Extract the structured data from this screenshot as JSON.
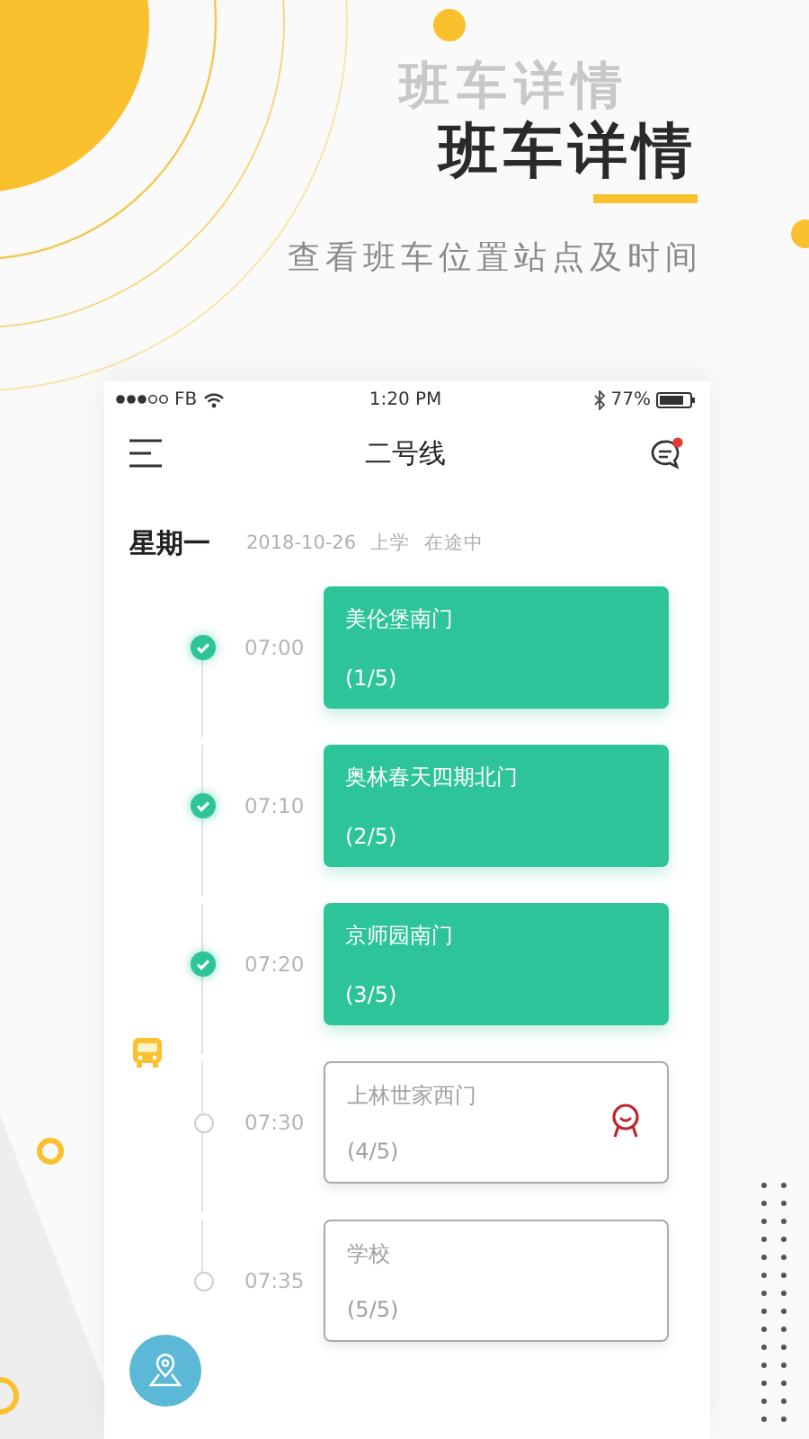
{
  "promo": {
    "title_echo": "班车详情",
    "title": "班车详情",
    "subtitle": "查看班车位置站点及时间"
  },
  "status_bar": {
    "carrier": "FB",
    "time": "1:20 PM",
    "battery": "77%"
  },
  "nav": {
    "title": "二号线",
    "unread": true
  },
  "day": {
    "weekday": "星期一",
    "date": "2018-10-26",
    "trip": "上学",
    "status": "在途中"
  },
  "stops": [
    {
      "name": "美伦堡南门",
      "order": "(1/5)",
      "time": "07:00",
      "passed": true,
      "bus_here": false,
      "marked": false
    },
    {
      "name": "奥林春天四期北门",
      "order": "(2/5)",
      "time": "07:10",
      "passed": true,
      "bus_here": false,
      "marked": false
    },
    {
      "name": "京师园南门",
      "order": "(3/5)",
      "time": "07:20",
      "passed": true,
      "bus_here": false,
      "marked": false
    },
    {
      "name": "上林世家西门",
      "order": "(4/5)",
      "time": "07:30",
      "passed": false,
      "bus_here": true,
      "marked": true
    },
    {
      "name": "学校",
      "order": "(5/5)",
      "time": "07:35",
      "passed": false,
      "bus_here": false,
      "marked": false
    }
  ]
}
